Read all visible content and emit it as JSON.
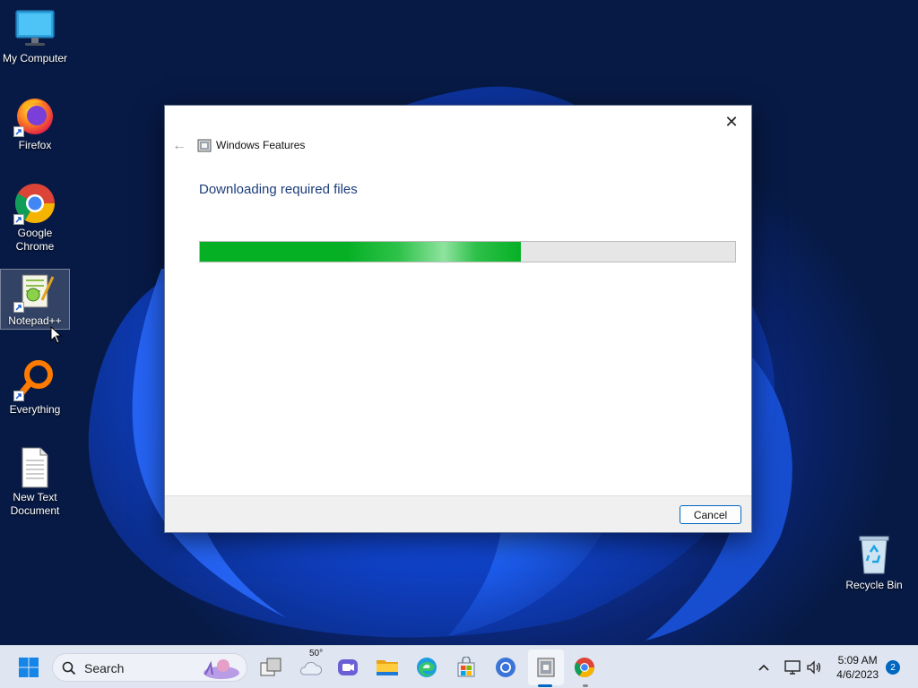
{
  "desktop": {
    "icons": [
      {
        "label": "My Computer"
      },
      {
        "label": "Firefox"
      },
      {
        "label": "Google Chrome"
      },
      {
        "label": "Notepad++"
      },
      {
        "label": "Everything"
      },
      {
        "label": "New Text Document"
      },
      {
        "label": "Recycle Bin"
      }
    ]
  },
  "dialog": {
    "app_title": "Windows Features",
    "heading": "Downloading required files",
    "progress_fraction": 0.6,
    "cancel_label": "Cancel",
    "close_glyph": "✕",
    "back_glyph": "←"
  },
  "taskbar": {
    "search_label": "Search",
    "weather_temp": "50°",
    "time": "5:09 AM",
    "date": "4/6/2023",
    "notification_count": "2",
    "pinned_icons": [
      "start-icon",
      "task-view-icon",
      "weather-icon",
      "teams-chat-icon",
      "file-explorer-icon",
      "edge-icon",
      "store-icon",
      "chrome-alt-icon",
      "windows-features-icon",
      "chrome-icon"
    ],
    "tray_icons": [
      "chevron-up-icon",
      "network-icon",
      "volume-icon"
    ]
  },
  "colors": {
    "accent": "#0067c0",
    "progress_green": "#06b025",
    "heading_blue": "#1c3d7a"
  }
}
